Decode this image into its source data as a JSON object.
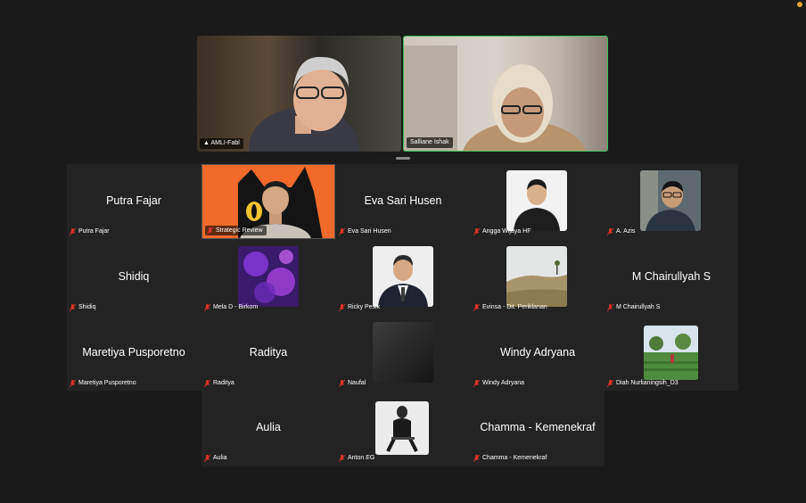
{
  "speakers": [
    {
      "name": "AMLI-Fabl",
      "pinned": true
    },
    {
      "name": "Salliane Ishak",
      "pinned": false
    }
  ],
  "grid": [
    {
      "name": "Putra Fajar",
      "big": "Putra Fajar",
      "kind": "name"
    },
    {
      "name": "Strategic Review",
      "kind": "video-cat"
    },
    {
      "name": "Eva Sari Husen",
      "big": "Eva Sari Husen",
      "kind": "name"
    },
    {
      "name": "Angga Wijaya HF",
      "kind": "photo-man"
    },
    {
      "name": "A. Azis",
      "kind": "photo-man2"
    },
    {
      "name": "Shidiq",
      "big": "Shidiq",
      "kind": "name"
    },
    {
      "name": "Mela D - Birkom",
      "kind": "photo-purple"
    },
    {
      "name": "Ricky Pesik",
      "kind": "photo-suit"
    },
    {
      "name": "Evinsa - Dit. Periklanan",
      "kind": "photo-land"
    },
    {
      "name": "M Chairullyah S",
      "big": "M Chairullyah S",
      "kind": "name"
    },
    {
      "name": "Maretiya Pusporetno",
      "big": "Maretiya Pusporetno",
      "kind": "name"
    },
    {
      "name": "Raditya",
      "big": "Raditya",
      "kind": "name"
    },
    {
      "name": "Naufal",
      "kind": "photo-dark"
    },
    {
      "name": "Windy Adryana",
      "big": "Windy Adryana",
      "kind": "name"
    },
    {
      "name": "Diah Nurlianingsih_D3",
      "kind": "photo-field"
    },
    {
      "name": "Aulia",
      "big": "Aulia",
      "kind": "name"
    },
    {
      "name": "Anton EG",
      "kind": "photo-bw"
    },
    {
      "name": "Chamma - Kemenekraf",
      "big": "Chamma - Kemenekraf",
      "kind": "name"
    }
  ],
  "colors": {
    "active_speaker_border": "#3ec05a",
    "muted_icon": "#e0312b"
  }
}
